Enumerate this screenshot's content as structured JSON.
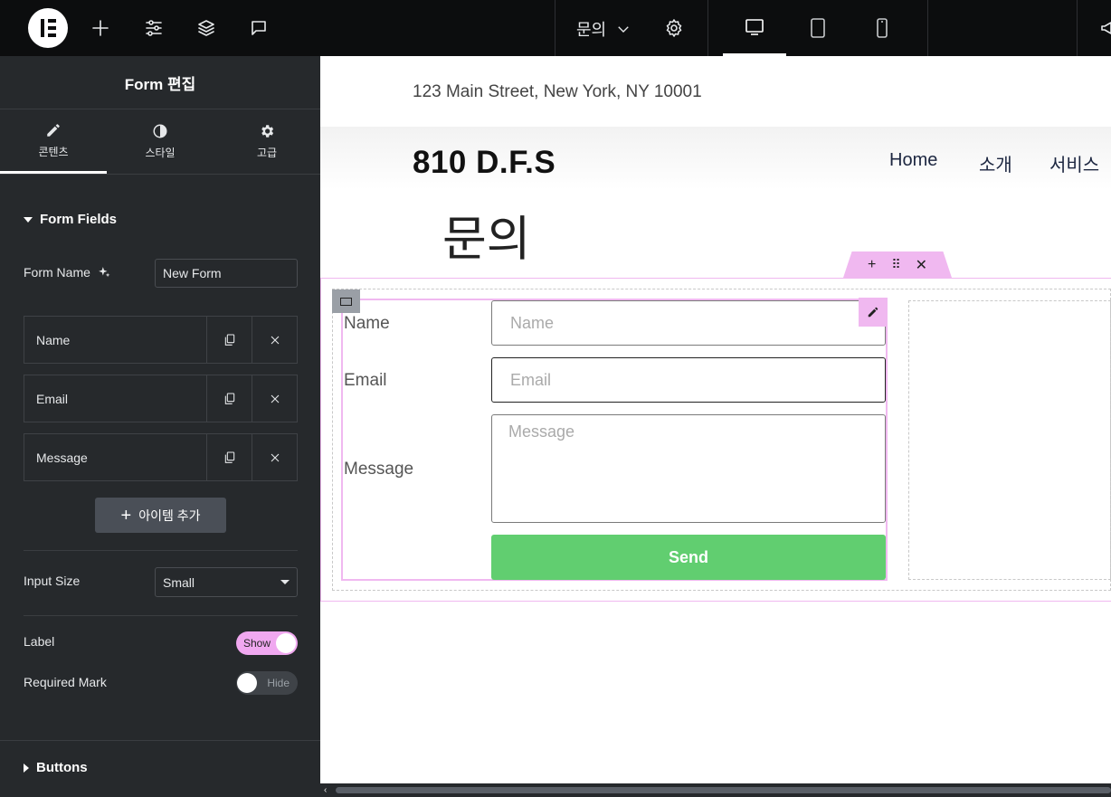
{
  "topbar": {
    "page_name": "문의"
  },
  "panel": {
    "title": "Form 편집",
    "tabs": [
      {
        "label": "콘텐츠",
        "icon": "pencil-icon",
        "active": true
      },
      {
        "label": "스타일",
        "icon": "half-circle-icon",
        "active": false
      },
      {
        "label": "고급",
        "icon": "gear-icon",
        "active": false
      }
    ],
    "form_fields_title": "Form Fields",
    "form_name_label": "Form Name",
    "form_name_value": "New Form",
    "fields": [
      {
        "label": "Name"
      },
      {
        "label": "Email"
      },
      {
        "label": "Message"
      }
    ],
    "add_item_label": "아이템 추가",
    "input_size_label": "Input Size",
    "input_size_value": "Small",
    "label_label": "Label",
    "label_toggle": "Show",
    "required_label": "Required Mark",
    "required_toggle": "Hide",
    "buttons_title": "Buttons"
  },
  "canvas": {
    "address": "123 Main Street, New York, NY 10001",
    "brand": "810 D.F.S",
    "nav": [
      "Home",
      "소개",
      "서비스"
    ],
    "page_title": "문의",
    "form": {
      "name_label": "Name",
      "name_placeholder": "Name",
      "email_label": "Email",
      "email_placeholder": "Email",
      "message_label": "Message",
      "message_placeholder": "Message",
      "send_label": "Send"
    }
  },
  "colors": {
    "accent": "#f0b8f0",
    "send": "#61ce70",
    "panel": "#26292c",
    "topbar": "#0c0d0e"
  }
}
